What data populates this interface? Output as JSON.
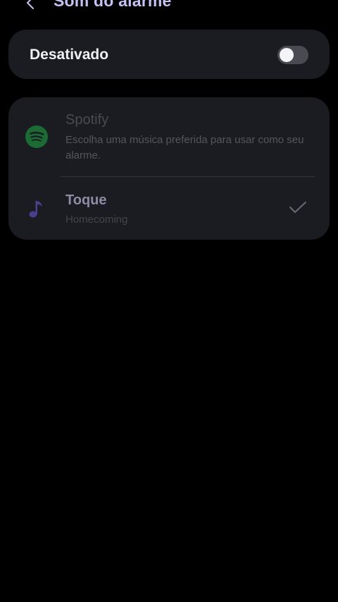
{
  "header": {
    "title": "Som do alarme",
    "back_icon": "chevron-left-icon"
  },
  "toggle": {
    "label": "Desativado",
    "enabled": false
  },
  "options": [
    {
      "id": "spotify",
      "title": "Spotify",
      "description": "Escolha uma música preferida para usar como seu alarme.",
      "icon": "spotify-icon",
      "icon_color": "#1c6b34",
      "selected": false
    },
    {
      "id": "toque",
      "title": "Toque",
      "subtitle": "Homecoming",
      "icon": "music-note-icon",
      "icon_color": "#4a3f8c",
      "selected": true
    }
  ],
  "colors": {
    "background": "#000000",
    "card": "#1b1b22",
    "title_accent": "#c5c2f2"
  }
}
